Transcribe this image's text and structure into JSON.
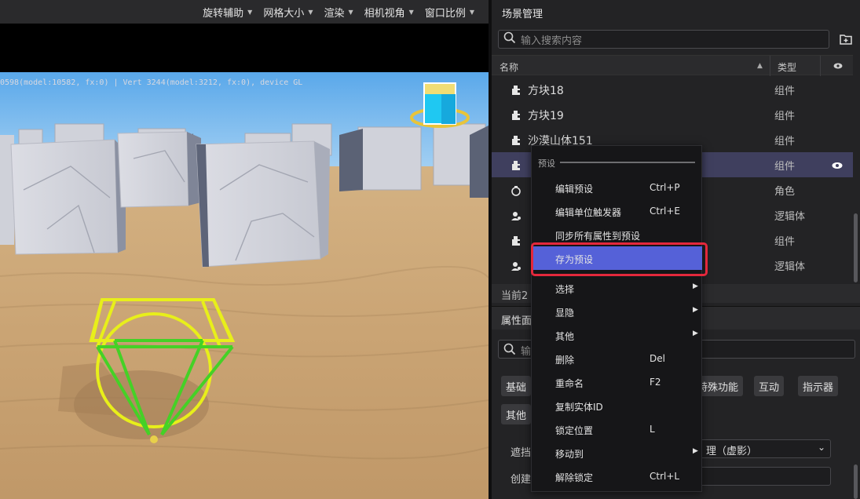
{
  "top_menu": [
    {
      "label": "旋转辅助"
    },
    {
      "label": "网格大小"
    },
    {
      "label": "渲染"
    },
    {
      "label": "相机视角"
    },
    {
      "label": "窗口比例"
    }
  ],
  "viewport": {
    "stats_text": "0598(model:10582, fx:0) | Vert 3244(model:3212, fx:0), device GL"
  },
  "scene_panel": {
    "title": "场景管理",
    "search_placeholder": "输入搜索内容",
    "columns": {
      "name": "名称",
      "type": "类型"
    },
    "rows": [
      {
        "name": "方块18",
        "type": "组件",
        "icon": "component-icon"
      },
      {
        "name": "方块19",
        "type": "组件",
        "icon": "component-icon"
      },
      {
        "name": "沙漠山体151",
        "type": "组件",
        "icon": "component-icon"
      },
      {
        "name": "",
        "type": "组件",
        "icon": "component-icon"
      },
      {
        "name": "",
        "type": "角色",
        "icon": "character-icon"
      },
      {
        "name": "",
        "type": "逻辑体",
        "icon": "logic-icon"
      },
      {
        "name": "",
        "type": "组件",
        "icon": "component-icon"
      },
      {
        "name": "",
        "type": "逻辑体",
        "icon": "logic-icon"
      }
    ],
    "current_text": "当前2"
  },
  "property_panel": {
    "title": "属性面",
    "search_placeholder": "输",
    "tags_row1": [
      "基础",
      "特殊功能",
      "互动",
      "指示器"
    ],
    "tags_row2": [
      "其他"
    ],
    "occlusion_label": "遮挡",
    "occlusion_value": "理（虚影）",
    "create_label": "创建"
  },
  "context_menu": {
    "section_title": "预设",
    "items": [
      {
        "label": "编辑预设",
        "shortcut": "Ctrl+P",
        "arrow": ""
      },
      {
        "label": "编辑单位触发器",
        "shortcut": "Ctrl+E",
        "arrow": ""
      },
      {
        "label": "同步所有属性到预设",
        "shortcut": "",
        "arrow": ""
      },
      {
        "label": "存为预设",
        "shortcut": "",
        "arrow": ""
      },
      {
        "label": "选择",
        "shortcut": "",
        "arrow": "▶"
      },
      {
        "label": "显隐",
        "shortcut": "",
        "arrow": "▶"
      },
      {
        "label": "其他",
        "shortcut": "",
        "arrow": "▶"
      },
      {
        "label": "删除",
        "shortcut": "Del",
        "arrow": ""
      },
      {
        "label": "重命名",
        "shortcut": "F2",
        "arrow": ""
      },
      {
        "label": "复制实体ID",
        "shortcut": "",
        "arrow": ""
      },
      {
        "label": "锁定位置",
        "shortcut": "L",
        "arrow": ""
      },
      {
        "label": "移动到",
        "shortcut": "",
        "arrow": "▶"
      },
      {
        "label": "解除锁定",
        "shortcut": "Ctrl+L",
        "arrow": ""
      }
    ],
    "highlighted_item": "存为预设"
  },
  "colors": {
    "accent": "#5561d8",
    "highlight_frame": "#e4283c",
    "selected_row": "#3f3f5e"
  }
}
